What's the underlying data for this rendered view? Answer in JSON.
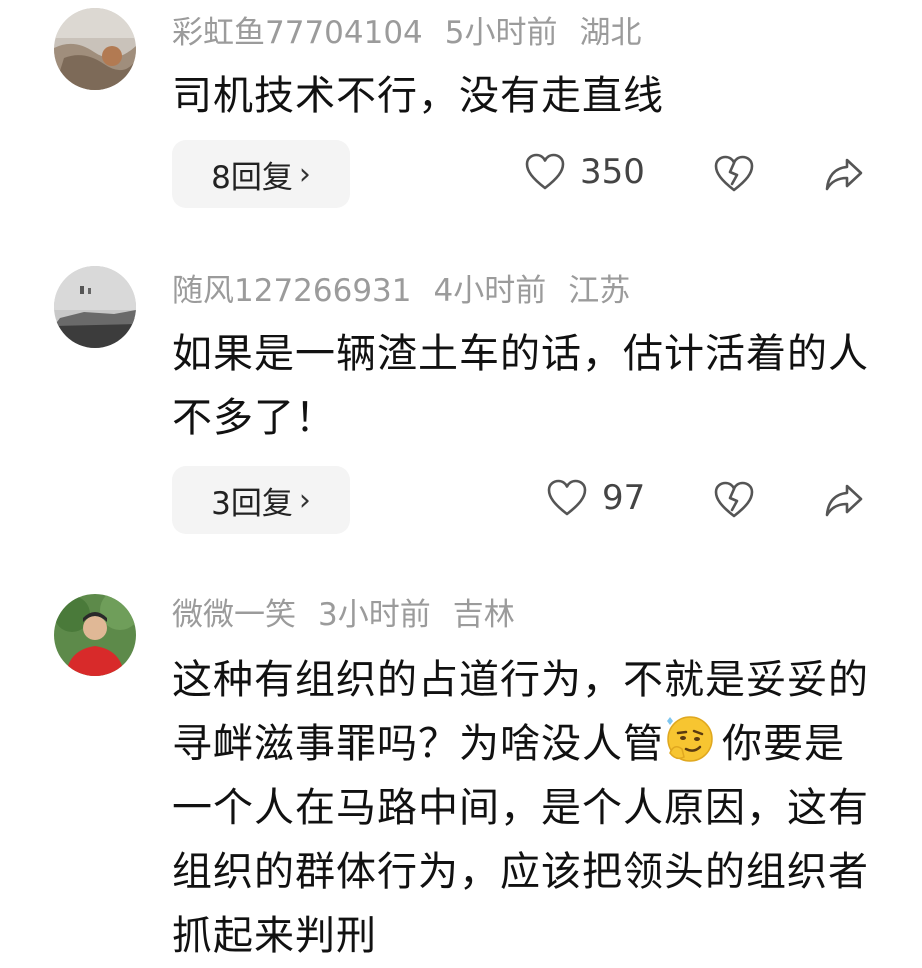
{
  "comments": [
    {
      "username": "彩虹鱼77704104",
      "time": "5小时前",
      "location": "湖北",
      "text": "司机技术不行，没有走直线",
      "replies": "8回复",
      "likes": "350"
    },
    {
      "username": "随风127266931",
      "time": "4小时前",
      "location": "江苏",
      "text": "如果是一辆渣土车的话，估计活着的人不多了！",
      "replies": "3回复",
      "likes": "97"
    },
    {
      "username": "微微一笑",
      "time": "3小时前",
      "location": "吉林",
      "text_part1": "这种有组织的占道行为，不就是妥妥的寻衅滋事罪吗？为啥没人管",
      "emoji": "thinking-smirk-emoji",
      "text_part2": "你要是一个人在马路中间，是个人原因，这有组织的群体行为，应该把领头的组织者抓起来判刑"
    }
  ],
  "icons": {
    "chevron": "›",
    "like": "heart-outline-icon",
    "dislike": "broken-heart-icon",
    "share": "share-arrow-icon"
  }
}
